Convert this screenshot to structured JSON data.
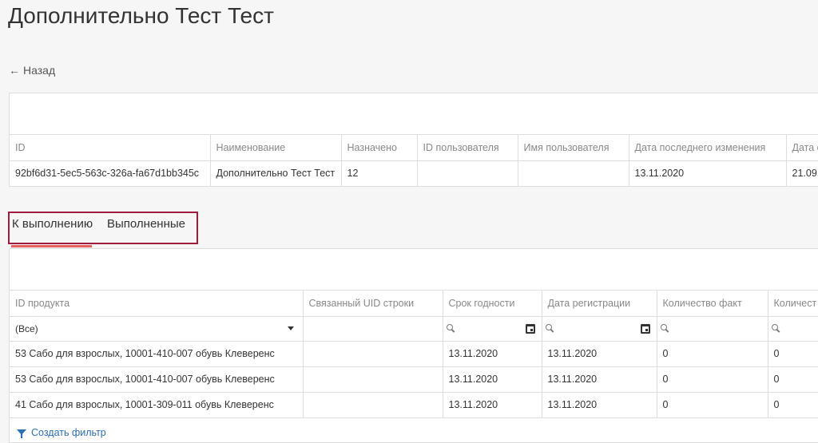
{
  "header": {
    "title": "Дополнительно Тест Тест",
    "back_label": "Назад",
    "back_arrow": "←"
  },
  "summary": {
    "columns": [
      "ID",
      "Наименование",
      "Назначено",
      "ID пользователя",
      "Имя пользователя",
      "Дата последнего изменения",
      "Дата с"
    ],
    "row": [
      "92bf6d31-5ec5-563c-326a-fa67d1bb345c",
      "Дополнительно Тест Тест",
      "12",
      "",
      "",
      "13.11.2020",
      "21.09."
    ]
  },
  "tabs": [
    {
      "label": "К выполнению",
      "active": true
    },
    {
      "label": "Выполненные",
      "active": false
    }
  ],
  "items": {
    "columns": [
      "ID продукта",
      "Связанный UID строки",
      "Срок годности",
      "Дата регистрации",
      "Количество факт",
      "Количест"
    ],
    "filter_select_value": "(Все)",
    "rows": [
      [
        "53 Сабо для взрослых, 10001-410-007 обувь Клеверенс",
        "",
        "13.11.2020",
        "13.11.2020",
        "0",
        "0"
      ],
      [
        "53 Сабо для взрослых, 10001-410-007 обувь Клеверенс",
        "",
        "13.11.2020",
        "13.11.2020",
        "0",
        "0"
      ],
      [
        "41 Сабо для взрослых, 10001-309-011 обувь Клеверенс",
        "",
        "13.11.2020",
        "13.11.2020",
        "0",
        "0"
      ]
    ]
  },
  "footer": {
    "create_filter_label": "Создать фильтр"
  },
  "colors": {
    "accent": "#e8605a",
    "highlight_box": "#a01c3c",
    "link": "#2a6fb8"
  }
}
